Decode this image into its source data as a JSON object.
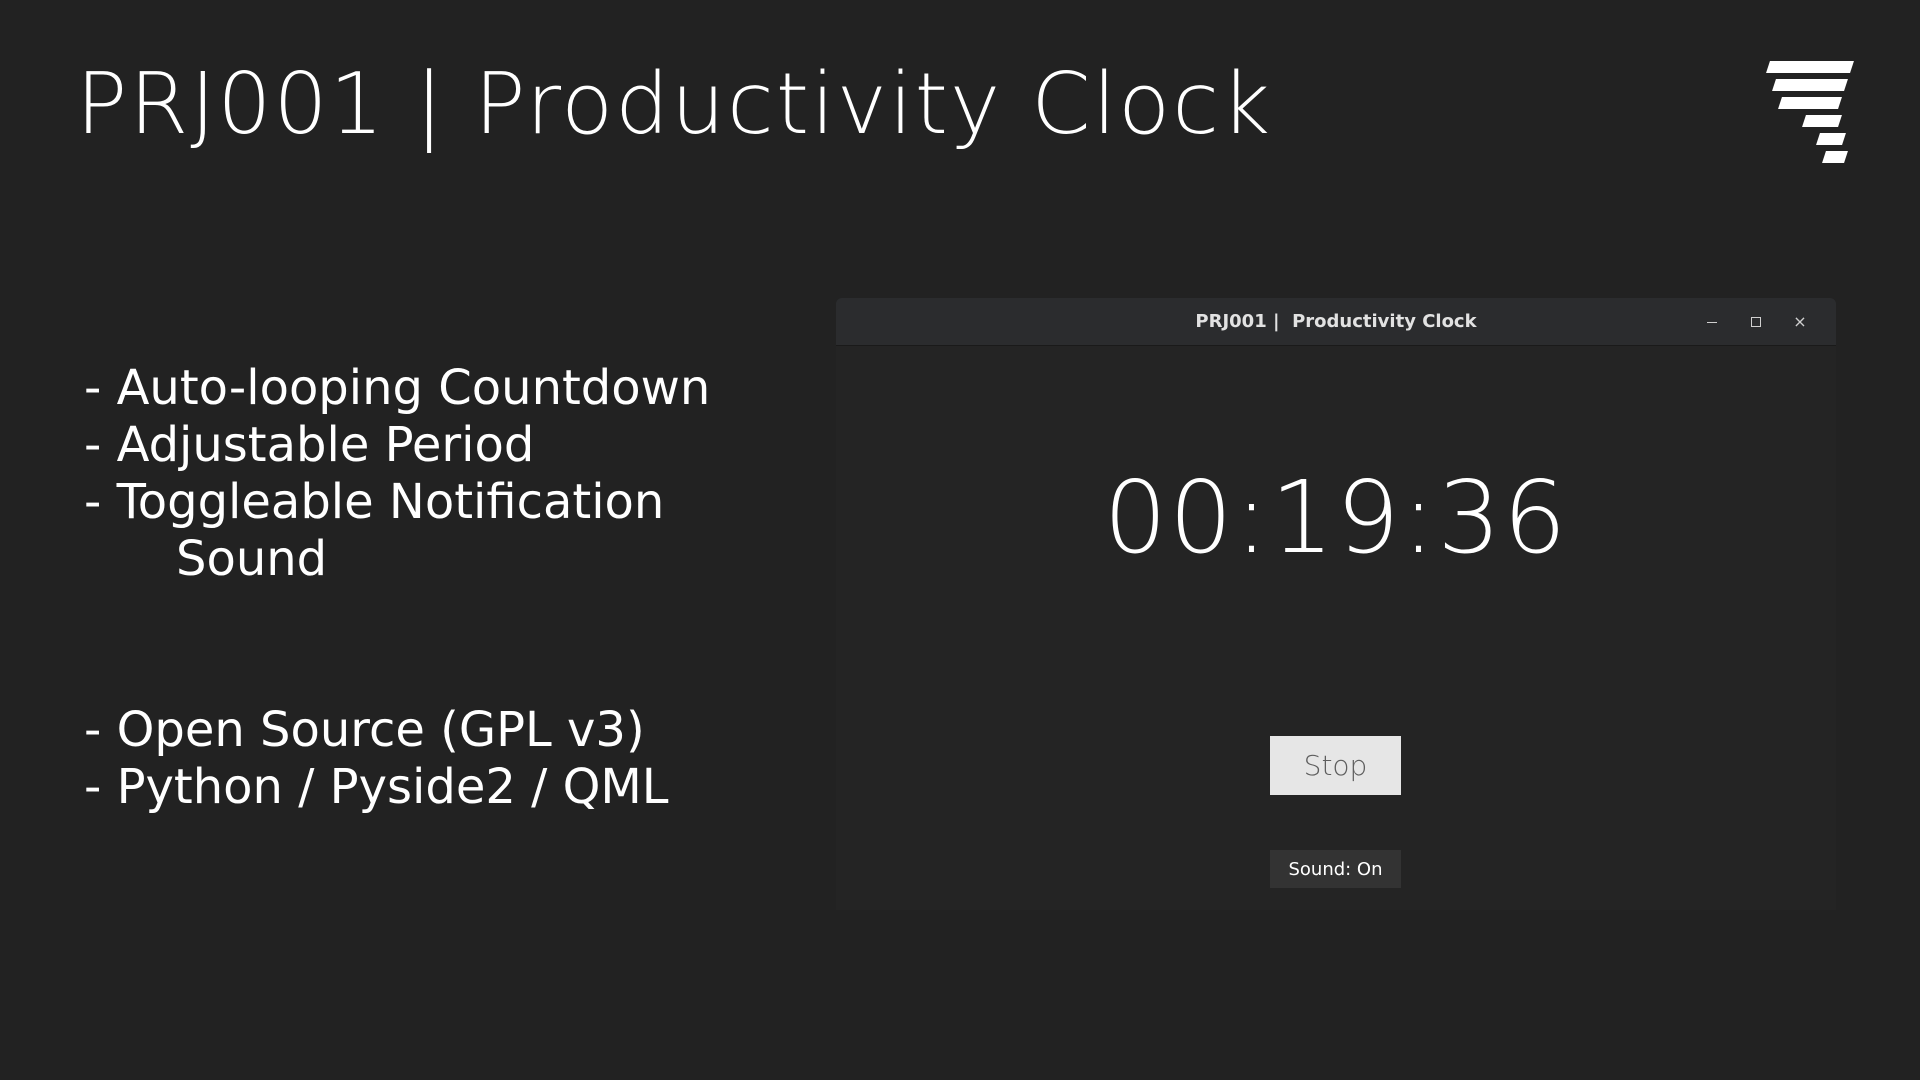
{
  "slide": {
    "title": "PRJ001 | Productivity Clock"
  },
  "logo": {
    "icon": "stacked-bars-logo",
    "color": "#ffffff"
  },
  "features": {
    "items": [
      "- Auto-looping Countdown",
      "- Adjustable Period",
      "- Toggleable Notification",
      "Sound",
      "- Open Source (GPL v3)",
      "- Python / Pyside2 / QML"
    ]
  },
  "window": {
    "title": "PRJ001 |  Productivity Clock",
    "controls": {
      "minimize_icon": "minimize-icon",
      "maximize_icon": "maximize-icon",
      "close_icon": "close-icon",
      "close_glyph": "×"
    },
    "timer": "00:19:36",
    "stop_label": "Stop",
    "sound_label": "Sound: On"
  },
  "colors": {
    "background": "#222222",
    "window_background": "#242424",
    "titlebar": "#2b2c2e",
    "stop_button": "#e6e6e6",
    "sound_button": "#333333",
    "text": "#ffffff"
  }
}
